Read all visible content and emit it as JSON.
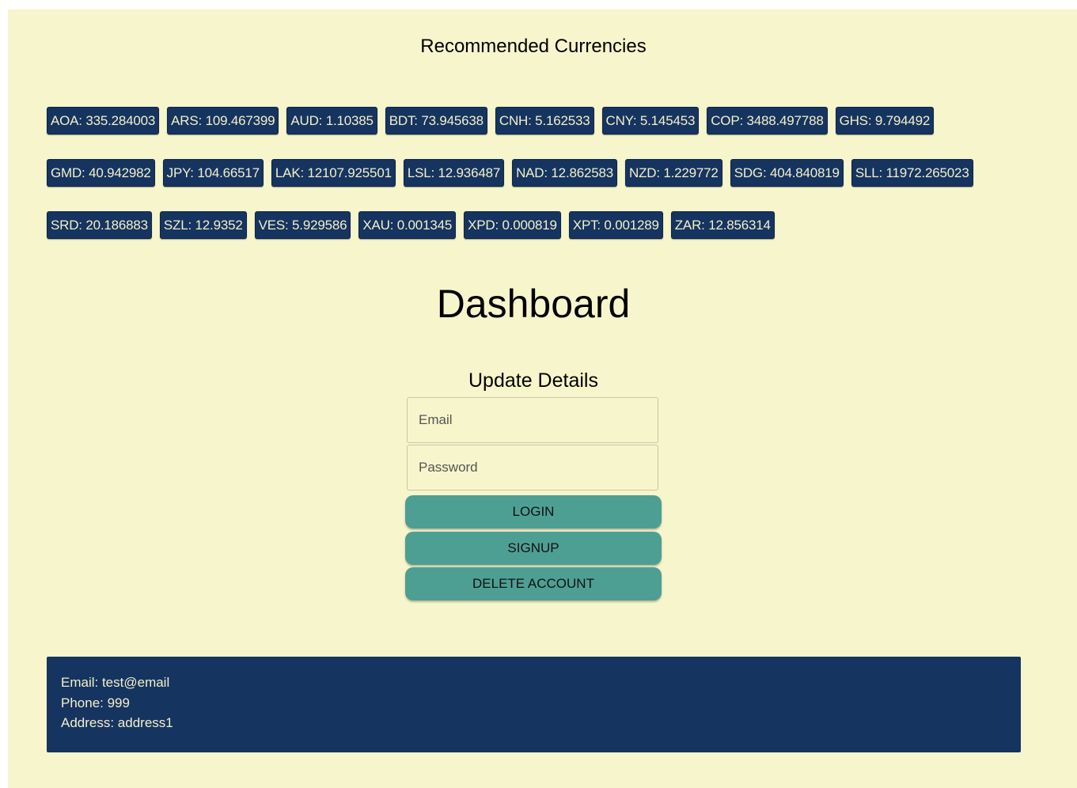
{
  "recommended": {
    "title": "Recommended Currencies",
    "rows": [
      [
        "AOA: 335.284003",
        "ARS: 109.467399",
        "AUD: 1.10385",
        "BDT: 73.945638",
        "CNH: 5.162533",
        "CNY: 5.145453",
        "COP: 3488.497788",
        "GHS: 9.794492"
      ],
      [
        "GMD: 40.942982",
        "JPY: 104.66517",
        "LAK: 12107.925501",
        "LSL: 12.936487",
        "NAD: 12.862583",
        "NZD: 1.229772",
        "SDG: 404.840819",
        "SLL: 11972.265023"
      ],
      [
        "SRD: 20.186883",
        "SZL: 12.9352",
        "VES: 5.929586",
        "XAU: 0.001345",
        "XPD: 0.000819",
        "XPT: 0.001289",
        "ZAR: 12.856314"
      ]
    ]
  },
  "dashboard": {
    "title": "Dashboard"
  },
  "form": {
    "title": "Update Details",
    "email_placeholder": "Email",
    "password_placeholder": "Password",
    "login_label": "LOGIN",
    "signup_label": "SIGNUP",
    "delete_label": "DELETE ACCOUNT"
  },
  "user": {
    "email": "Email: test@email",
    "phone": "Phone: 999",
    "address": "Address: address1"
  },
  "colors": {
    "background": "#f7f5cb",
    "chip": "#163460",
    "button": "#4e9f93",
    "footer": "#163460"
  }
}
